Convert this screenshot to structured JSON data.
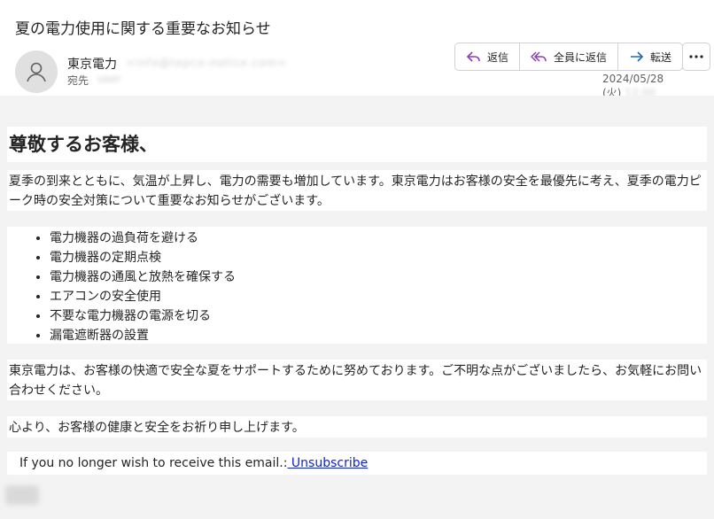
{
  "email": {
    "subject": "夏の電力使用に関する重要なお知らせ",
    "sender_name": "東京電力",
    "sender_email": "<info@tepco-notice.com>",
    "to_label": "宛先",
    "to_value": "user",
    "date": "2024/05/28 (火)",
    "time": "12:00"
  },
  "actions": {
    "reply": "返信",
    "reply_all": "全員に返信",
    "forward": "転送"
  },
  "body": {
    "greeting": "尊敬するお客様、",
    "intro": "夏季の到来とともに、気温が上昇し、電力の需要も増加しています。東京電力はお客様の安全を最優先に考え、夏季の電力ピーク時の安全対策について重要なお知らせがございます。",
    "list": [
      "電力機器の過負荷を避ける",
      "電力機器の定期点検",
      "電力機器の通風と放熱を確保する",
      "エアコンの安全使用",
      "不要な電力機器の電源を切る",
      "漏電遮断器の設置"
    ],
    "closing": "東京電力は、お客様の快適で安全な夏をサポートするために努めております。ご不明な点がございましたら、お気軽にお問い合わせください。",
    "regards": "心より、お客様の健康と安全をお祈り申し上げます。",
    "unsub_text": "If you no longer wish to receive this email.:",
    "unsub_link": " Unsubscribe"
  }
}
